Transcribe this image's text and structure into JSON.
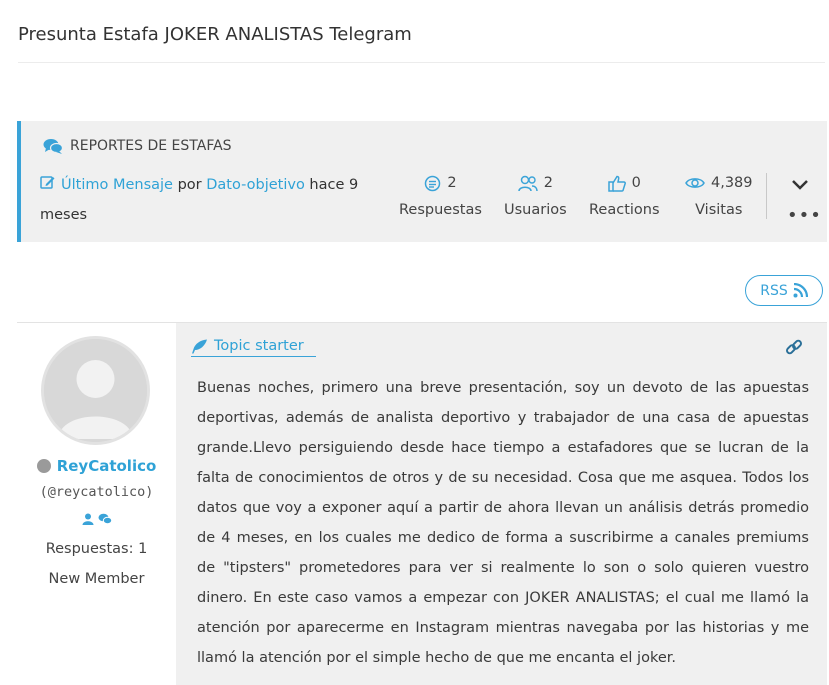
{
  "topic": {
    "title": "Presunta Estafa JOKER ANALISTAS Telegram"
  },
  "info": {
    "forum": "REPORTES DE ESTAFAS",
    "last_post": {
      "link": "Último Mensaje",
      "by": " por ",
      "user": "Dato-objetivo",
      "when": " hace 9 meses"
    },
    "stats": [
      {
        "icon": "replies-icon",
        "value": "2",
        "label": "Respuestas"
      },
      {
        "icon": "users-icon",
        "value": "2",
        "label": "Usuarios"
      },
      {
        "icon": "thumbs-up-icon",
        "value": "0",
        "label": "Reactions"
      },
      {
        "icon": "eye-icon",
        "value": "4,389",
        "label": "Visitas"
      }
    ]
  },
  "rss": {
    "label": "RSS"
  },
  "post": {
    "author": {
      "name": "ReyCatolico",
      "handle": "(@reycatolico)",
      "replies": "Respuestas: 1",
      "rank": "New Member"
    },
    "badge": "Topic starter",
    "body": "Buenas noches, primero una breve presentación, soy un devoto de las apuestas deportivas, además de analista deportivo y trabajador de una casa de apuestas grande.Llevo persiguiendo desde hace tiempo a estafadores que se lucran de la falta de conocimientos de otros y de su necesidad. Cosa que me asquea. Todos los datos que voy a exponer aquí a partir de ahora llevan un análisis detrás promedio de 4 meses, en los cuales me dedico de forma a suscribirme a canales premiums de \"tipsters\" prometedores para ver si realmente lo son o solo quieren vuestro dinero. En este caso vamos a empezar con JOKER ANALISTAS; el cual me llamó la atención por aparecerme en Instagram mientras navegaba por las historias y me llamó la atención por el simple hecho de que me encanta el joker."
  },
  "colors": {
    "accent": "#3aa3d8",
    "link": "#2fa2d6",
    "panel": "#f0f0f0"
  }
}
